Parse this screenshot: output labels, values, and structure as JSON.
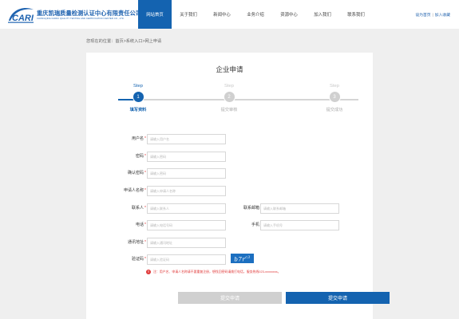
{
  "header": {
    "logo_name": "重庆凯瑞质量检测认证中心有限责任公司",
    "logo_en": "CHONGQING KAIRUI QUALITY TESTING AND CERTIFICATION CENTER CO., LTD.",
    "nav": [
      "网站首页",
      "关于我们",
      "新闻中心",
      "业务介绍",
      "资源中心",
      "加入我们",
      "联系我们"
    ],
    "active_nav_index": 0,
    "top_links": {
      "homepage": "设为首页",
      "favorite": "加入收藏"
    },
    "brand_color": "#1463b0"
  },
  "breadcrumb": "您现在的位置：首页>系统入口>网上申请",
  "panel": {
    "title": "企业申请",
    "steps": [
      {
        "word": "Step",
        "number": "1",
        "label": "填写资料",
        "active": true
      },
      {
        "word": "Step",
        "number": "2",
        "label": "提交审核",
        "active": false
      },
      {
        "word": "Step",
        "number": "3",
        "label": "提交成功",
        "active": false
      }
    ]
  },
  "form": {
    "username": {
      "label": "用户名",
      "placeholder": "请输入用户名"
    },
    "password": {
      "label": "密码",
      "placeholder": "请输入密码"
    },
    "confirm_password": {
      "label": "确认密码",
      "placeholder": "请输入密码"
    },
    "applicant": {
      "label": "申请人名称",
      "placeholder": "请输入申请人名称"
    },
    "contact": {
      "label": "联系人",
      "placeholder": "请输入联系人"
    },
    "email": {
      "label": "联系邮箱",
      "placeholder": "请输入联系邮箱"
    },
    "phone": {
      "label": "电话",
      "placeholder": "请输入电话号码"
    },
    "mobile": {
      "label": "手机",
      "placeholder": "请输入手机号"
    },
    "address": {
      "label": "通讯地址",
      "placeholder": "请输入通讯地址"
    },
    "verify": {
      "label": "验证码",
      "placeholder": "请输入验证码"
    },
    "required_mark": "*",
    "captcha": {
      "text": "b7r",
      "sup": "c3"
    },
    "note": "注：用户名、申请人名称请不要重复注册，想找回密码请拨打电话，服务热线023-xxxxxxxx。",
    "note_icon": "!",
    "buttons": {
      "reset": "提交申请",
      "submit": "提交申请"
    }
  }
}
